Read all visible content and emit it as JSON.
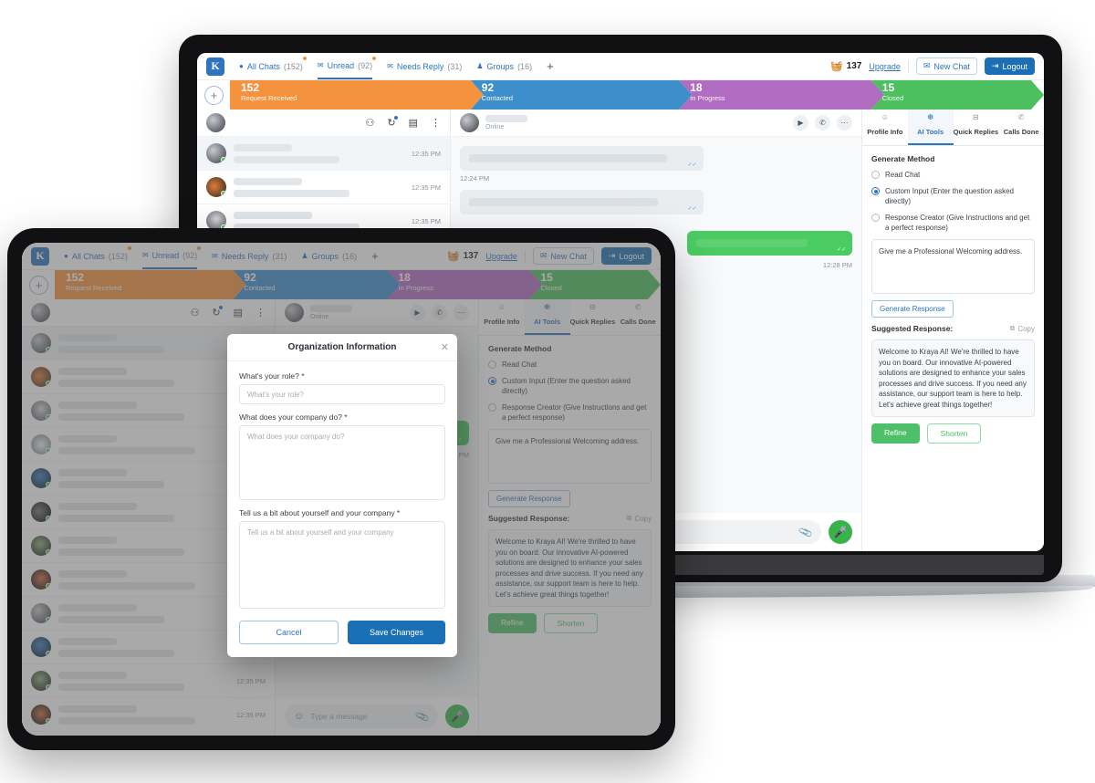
{
  "app": {
    "brand_logo": "K",
    "tabs": [
      {
        "icon": "chat-bubble-icon",
        "label": "All Chats",
        "count": "(152)",
        "active": false,
        "dot": true
      },
      {
        "icon": "unread-mail-icon",
        "label": "Unread",
        "count": "(92)",
        "active": true,
        "dot": true
      },
      {
        "icon": "needs-reply-icon",
        "label": "Needs Reply",
        "count": "(31)",
        "active": false,
        "dot": false
      },
      {
        "icon": "groups-icon",
        "label": "Groups",
        "count": "(16)",
        "active": false,
        "dot": false
      }
    ],
    "add_tab": "+",
    "coins": {
      "icon": "coins-icon",
      "value": "137",
      "upgrade": "Upgrade"
    },
    "new_chat": "New Chat",
    "logout": "Logout",
    "pipeline": {
      "add": "+",
      "stages": [
        {
          "num": "152",
          "label": "Request Received",
          "color": "#f5923e"
        },
        {
          "num": "92",
          "label": "Contacted",
          "color": "#3d8fcc"
        },
        {
          "num": "18",
          "label": "In Progress",
          "color": "#b06cc0"
        },
        {
          "num": "15",
          "label": "Closed",
          "color": "#4cbf5e"
        }
      ]
    },
    "list_head_icons": [
      "contacts-icon",
      "refresh-icon",
      "message-icon",
      "more-vertical-icon"
    ],
    "chat_rows": [
      {
        "time": "12:35 PM",
        "selected": true,
        "avatar": "a1"
      },
      {
        "time": "12:35 PM",
        "selected": false,
        "avatar": "a2"
      },
      {
        "time": "12:35 PM",
        "selected": false,
        "avatar": "a3"
      },
      {
        "time": "12:35 PM",
        "selected": false,
        "avatar": "a4"
      },
      {
        "time": "12:35 PM",
        "selected": false,
        "avatar": "a5"
      },
      {
        "time": "12:35 PM",
        "selected": false,
        "avatar": "a6"
      },
      {
        "time": "12:35 PM",
        "selected": false,
        "avatar": "a7"
      },
      {
        "time": "12:35 PM",
        "selected": false,
        "avatar": "a8"
      },
      {
        "time": "12:35 PM",
        "selected": false,
        "avatar": "a1"
      },
      {
        "time": "12:35 PM",
        "selected": false,
        "avatar": "a5"
      },
      {
        "time": "12:35 PM",
        "selected": false,
        "avatar": "a7"
      },
      {
        "time": "12:35 PM",
        "selected": false,
        "avatar": "a8"
      }
    ],
    "conversation": {
      "status": "Online",
      "head_icons": [
        "video-call-icon",
        "phone-call-icon",
        "more-horizontal-icon"
      ],
      "msg_time_1": "12:24 PM",
      "msg_time_2": "12:28 PM",
      "composer_placeholder": "Type a message",
      "attach_icon": "paperclip-icon",
      "mic_icon": "microphone-icon",
      "emoji_icon": "emoji-smiley-icon"
    },
    "ai_panel": {
      "tabs": [
        {
          "icon": "profile-icon",
          "label": "Profile Info",
          "active": false
        },
        {
          "icon": "ai-sparkle-icon",
          "label": "AI Tools",
          "active": true
        },
        {
          "icon": "quick-reply-icon",
          "label": "Quick Replies",
          "active": false
        },
        {
          "icon": "calls-done-icon",
          "label": "Calls Done",
          "active": false
        }
      ],
      "generate_method_title": "Generate Method",
      "options": [
        {
          "label": "Read Chat",
          "selected": false
        },
        {
          "label": "Custom Input (Enter the question asked directly)",
          "selected": true
        },
        {
          "label": "Response Creator (Give Instructions and get a perfect response)",
          "selected": false
        }
      ],
      "input_value": "Give me a Professional Welcoming address.",
      "generate_button": "Generate Response",
      "suggested_label": "Suggested Response:",
      "copy_label": "Copy",
      "copy_icon": "copy-icon",
      "suggested_text": "Welcome to Kraya AI! We're thrilled to have you on board. Our innovative AI-powered solutions are designed to enhance your sales processes and drive success. If you need any assistance, our support team is here to help. Let's achieve great things together!",
      "refine_button": "Refine",
      "shorten_button": "Shorten"
    }
  },
  "modal": {
    "title": "Organization Information",
    "close_icon": "close-icon",
    "fields": [
      {
        "label": "What's your role? *",
        "placeholder": "What's your role?",
        "type": "input"
      },
      {
        "label": "What does your company do? *",
        "placeholder": "What does your company do?",
        "type": "textarea"
      },
      {
        "label": "Tell us a bit about yourself and your company *",
        "placeholder": "Tell us a bit about yourself and your company",
        "type": "textarea"
      }
    ],
    "cancel": "Cancel",
    "save": "Save Changes"
  },
  "colors": {
    "brand_blue": "#1a6fb5",
    "link_blue": "#2f74c0",
    "green": "#4ec06a",
    "stage_orange": "#f5923e",
    "stage_blue": "#3d8fcc",
    "stage_purple": "#b06cc0",
    "stage_green": "#4cbf5e"
  }
}
